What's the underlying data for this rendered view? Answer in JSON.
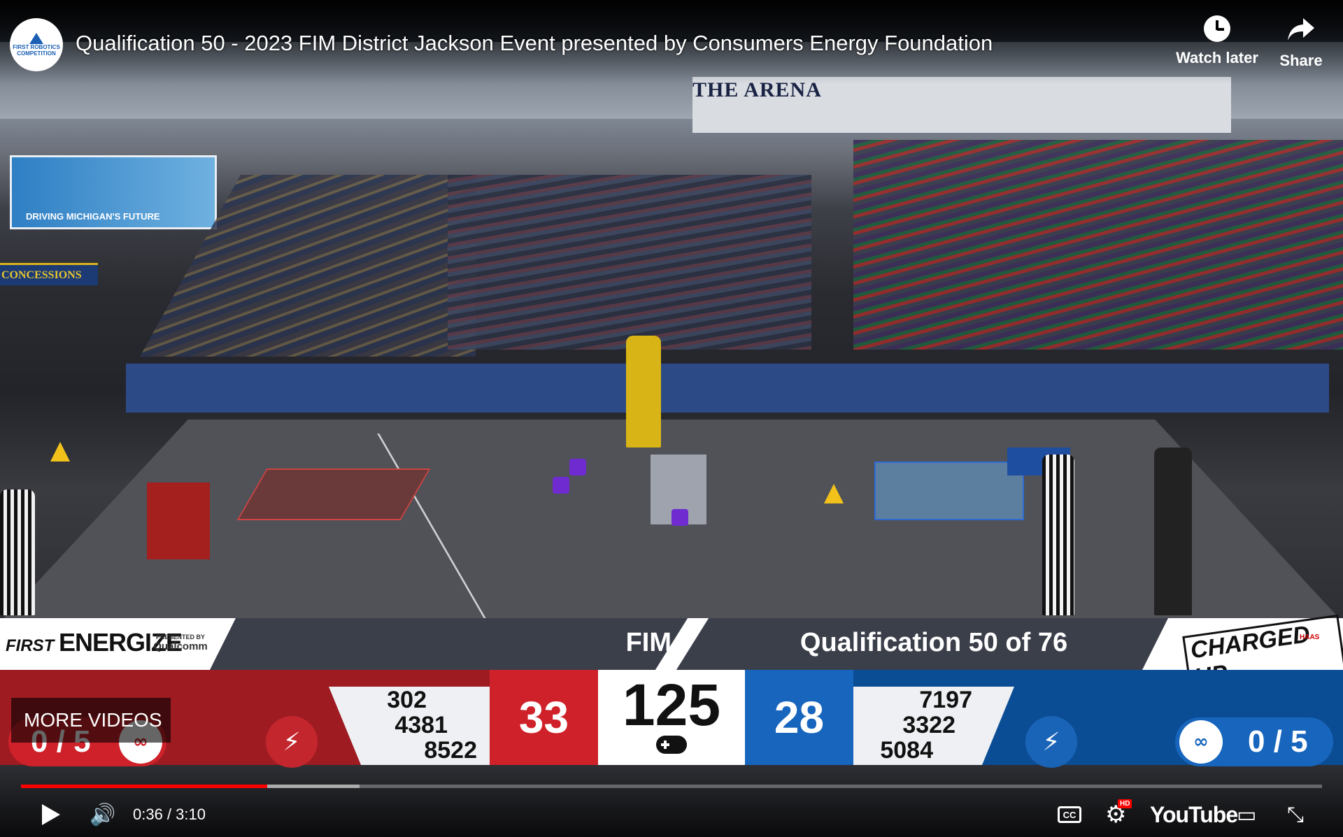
{
  "video": {
    "title": "Qualification 50 - 2023 FIM District Jackson Event presented by Consumers Energy Foundation",
    "channel_logo_text": "FIRST ROBOTICS COMPETITION"
  },
  "top_actions": {
    "watch_later": "Watch later",
    "share": "Share"
  },
  "scene_signage": {
    "arena": "THE ARENA",
    "banner": "DRIVING MICHIGAN'S FUTURE",
    "concessions": "CONCESSIONS"
  },
  "scoreboard": {
    "brand_left_first": "FIRST",
    "brand_left_energize": "ENERGIZE",
    "presented_by": "PRESENTED BY",
    "sponsor": "Qualcomm",
    "region": "FIM",
    "match": "Qualification 50 of 76",
    "game_logo": "CHARGED UP",
    "game_sponsor": "HAAS",
    "total": "125",
    "red": {
      "score": "33",
      "teams": [
        "302",
        "4381",
        "8522"
      ],
      "links": "0 / 5"
    },
    "blue": {
      "score": "28",
      "teams": [
        "7197",
        "3322",
        "5084"
      ],
      "links": "0 / 5"
    },
    "colors": {
      "red": "#9e1b22",
      "red_score": "#cf2129",
      "blue": "#0b4d94",
      "blue_score": "#1765bd"
    }
  },
  "overlay": {
    "more_videos": "MORE VIDEOS"
  },
  "player": {
    "current_time": "0:36",
    "duration": "3:10",
    "time_display": "0:36 / 3:10",
    "progress_fraction": 0.189,
    "buffered_fraction": 0.26,
    "quality_badge": "HD",
    "cc_label": "CC",
    "logo": "YouTube",
    "progress_color": "#ff0000"
  },
  "icons": [
    "play-icon",
    "volume-icon",
    "cc-icon",
    "settings-gear-icon",
    "youtube-logo",
    "cast-icon",
    "exit-fullscreen-icon",
    "clock-icon",
    "share-arrow-icon",
    "link-icon",
    "energy-icon",
    "gamepad-icon"
  ]
}
